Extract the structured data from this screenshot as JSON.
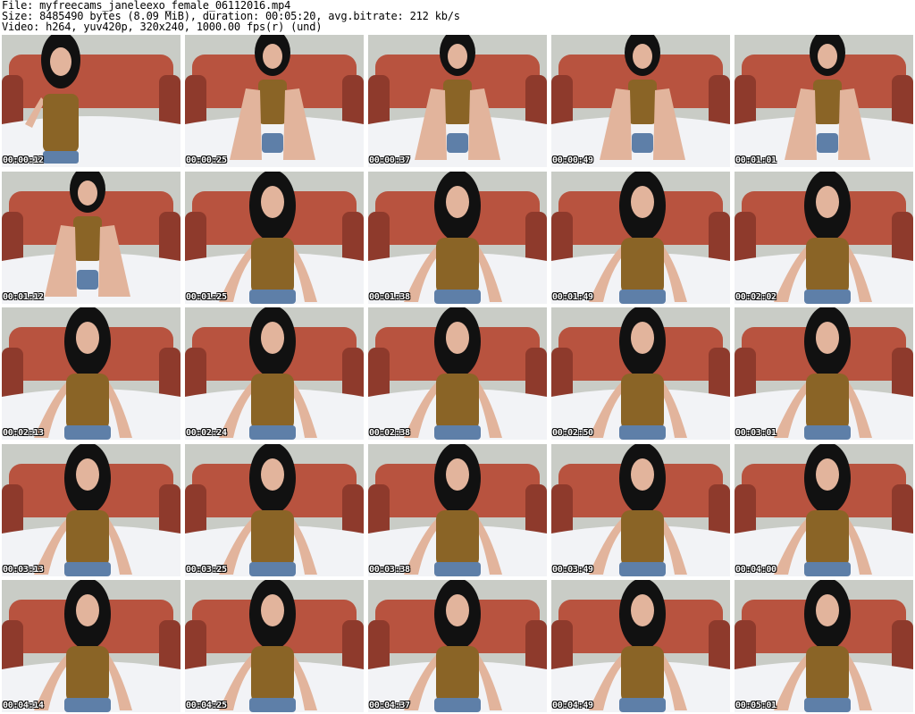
{
  "header": {
    "file_line": "File: myfreecams_janeleexo_female_06112016.mp4",
    "size_line": "Size: 8485490 bytes (8.09 MiB), duration: 00:05:20, avg.bitrate: 212 kb/s",
    "video_line": "Video: h264, yuv420p, 320x240, 1000.00 fps(r) (und)"
  },
  "colors": {
    "background": "#ffffff",
    "wall": "#c9ccc6",
    "sofa": "#b8533f",
    "sofa_dark": "#8e3a2c",
    "sheet": "#f2f3f6",
    "top": "#8a6426",
    "hair": "#111111",
    "skin": "#e2b49c",
    "shorts": "#5e7fa8",
    "timestamp": "#ffffff"
  },
  "thumbnails": [
    {
      "time": "00:00:12",
      "pose": "sitting"
    },
    {
      "time": "00:00:25",
      "pose": "knees-up"
    },
    {
      "time": "00:00:37",
      "pose": "knees-up"
    },
    {
      "time": "00:00:49",
      "pose": "knees-up"
    },
    {
      "time": "00:01:01",
      "pose": "knees-up"
    },
    {
      "time": "00:01:12",
      "pose": "knees-up"
    },
    {
      "time": "00:01:25",
      "pose": "close"
    },
    {
      "time": "00:01:38",
      "pose": "close"
    },
    {
      "time": "00:01:49",
      "pose": "close"
    },
    {
      "time": "00:02:02",
      "pose": "close"
    },
    {
      "time": "00:02:13",
      "pose": "close"
    },
    {
      "time": "00:02:24",
      "pose": "close"
    },
    {
      "time": "00:02:38",
      "pose": "close"
    },
    {
      "time": "00:02:50",
      "pose": "close"
    },
    {
      "time": "00:03:01",
      "pose": "close"
    },
    {
      "time": "00:03:13",
      "pose": "close"
    },
    {
      "time": "00:03:25",
      "pose": "close"
    },
    {
      "time": "00:03:38",
      "pose": "close"
    },
    {
      "time": "00:03:49",
      "pose": "close"
    },
    {
      "time": "00:04:00",
      "pose": "close"
    },
    {
      "time": "00:04:14",
      "pose": "close"
    },
    {
      "time": "00:04:25",
      "pose": "close"
    },
    {
      "time": "00:04:37",
      "pose": "close"
    },
    {
      "time": "00:04:49",
      "pose": "close"
    },
    {
      "time": "00:05:01",
      "pose": "close"
    }
  ]
}
